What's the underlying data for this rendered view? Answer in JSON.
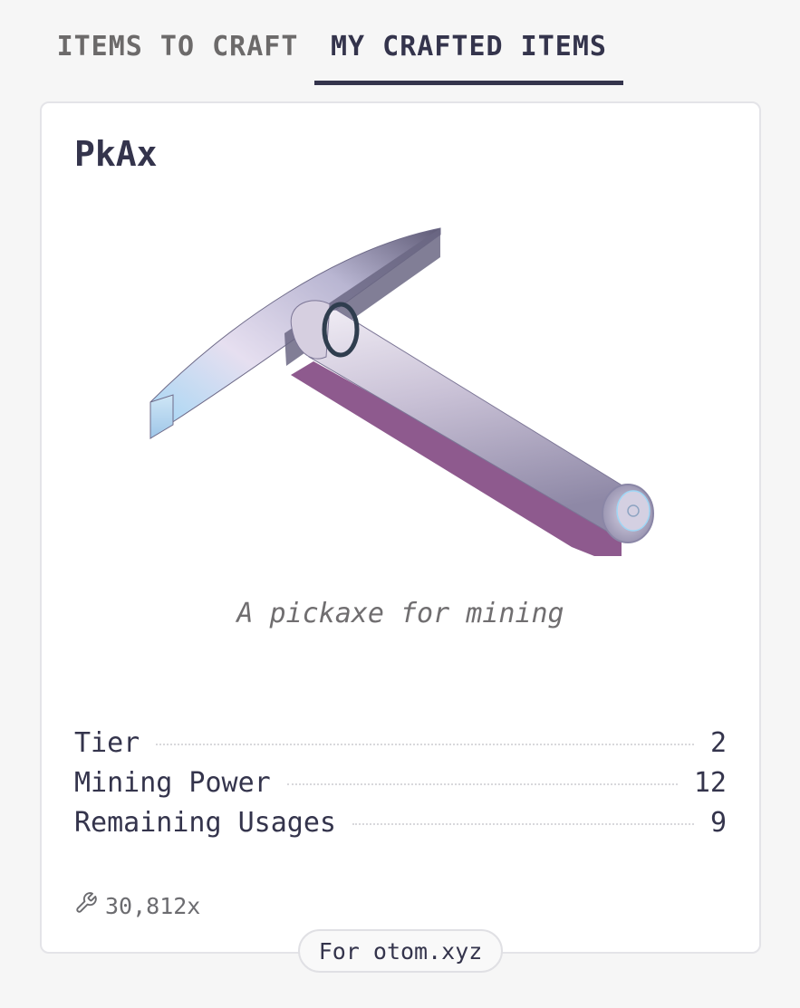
{
  "tabs": [
    {
      "label": "ITEMS TO CRAFT",
      "active": false
    },
    {
      "label": "MY CRAFTED ITEMS",
      "active": true
    }
  ],
  "item": {
    "name": "PkAx",
    "description": "A pickaxe for mining",
    "image_icon": "pickaxe-icon",
    "stats": [
      {
        "label": "Tier",
        "value": "2"
      },
      {
        "label": "Mining Power",
        "value": "12"
      },
      {
        "label": "Remaining Usages",
        "value": "9"
      }
    ],
    "crafted_count": "30,812x",
    "crafted_icon": "wrench-icon"
  },
  "footer": {
    "badge": "For otom.xyz"
  },
  "colors": {
    "text_primary": "#34344c",
    "tab_inactive": "#6c6a6a",
    "handle_shadow": "#8e5a8e",
    "accent_blue": "#9fd6f5"
  }
}
